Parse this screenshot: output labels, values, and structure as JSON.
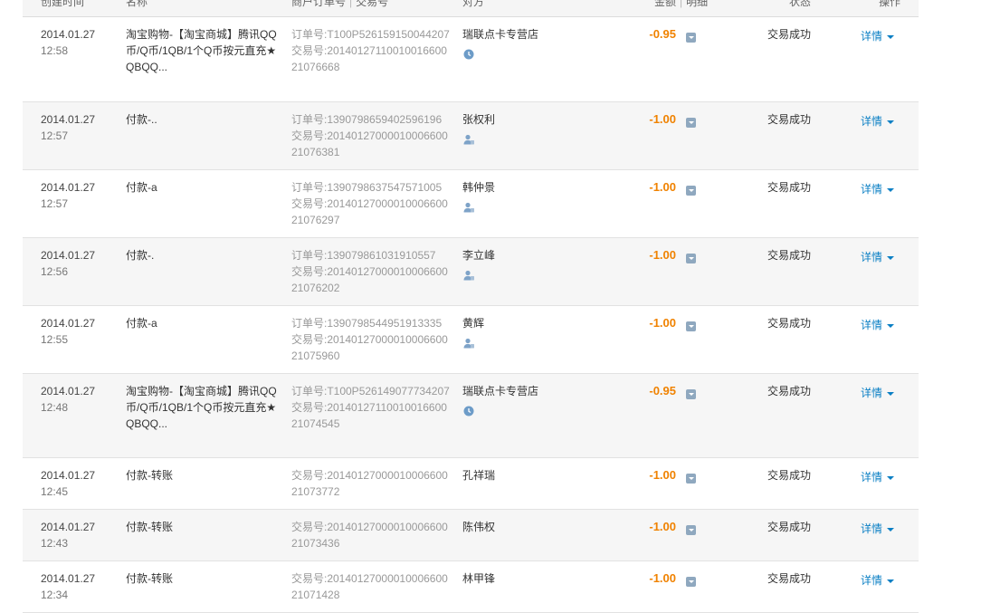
{
  "header": {
    "created_time": "创建时间",
    "name": "名称",
    "merchant_order": "商户订单号",
    "trade_no": "交易号",
    "counterparty": "对方",
    "amount": "金额",
    "detail": "明细",
    "status": "状态",
    "action": "操作"
  },
  "rows": [
    {
      "date": "2014.01.27",
      "time": "12:58",
      "name": "淘宝购物-【淘宝商城】腾讯QQ币/Q币/1QB/1个Q币按元直充★QBQQ...",
      "order": "订单号:T100P526159150044207",
      "trade": "交易号:2014012711001001660021076668",
      "party": "瑞联点卡专营店",
      "party_icon": "clock-icon",
      "amount": "-0.95",
      "status": "交易成功",
      "action": "详情"
    },
    {
      "date": "2014.01.27",
      "time": "12:57",
      "name": "付款-..",
      "order": "订单号:1390798659402596196",
      "trade": "交易号:2014012700001000660021076381",
      "party": "张权利",
      "party_icon": "user-icon",
      "amount": "-1.00",
      "status": "交易成功",
      "action": "详情"
    },
    {
      "date": "2014.01.27",
      "time": "12:57",
      "name": "付款-a",
      "order": "订单号:1390798637547571005",
      "trade": "交易号:2014012700001000660021076297",
      "party": "韩仲景",
      "party_icon": "user-icon",
      "amount": "-1.00",
      "status": "交易成功",
      "action": "详情"
    },
    {
      "date": "2014.01.27",
      "time": "12:56",
      "name": "付款-.",
      "order": "订单号:139079861031910557",
      "trade": "交易号:2014012700001000660021076202",
      "party": "李立峰",
      "party_icon": "user-icon",
      "amount": "-1.00",
      "status": "交易成功",
      "action": "详情"
    },
    {
      "date": "2014.01.27",
      "time": "12:55",
      "name": "付款-a",
      "order": "订单号:1390798544951913335",
      "trade": "交易号:2014012700001000660021075960",
      "party": "黄辉",
      "party_icon": "user-icon",
      "amount": "-1.00",
      "status": "交易成功",
      "action": "详情"
    },
    {
      "date": "2014.01.27",
      "time": "12:48",
      "name": "淘宝购物-【淘宝商城】腾讯QQ币/Q币/1QB/1个Q币按元直充★QBQQ...",
      "order": "订单号:T100P526149077734207",
      "trade": "交易号:2014012711001001660021074545",
      "party": "瑞联点卡专营店",
      "party_icon": "clock-icon",
      "amount": "-0.95",
      "status": "交易成功",
      "action": "详情"
    },
    {
      "date": "2014.01.27",
      "time": "12:45",
      "name": "付款-转账",
      "order": "",
      "trade": "交易号:2014012700001000660021073772",
      "party": "孔祥瑞",
      "party_icon": "",
      "amount": "-1.00",
      "status": "交易成功",
      "action": "详情"
    },
    {
      "date": "2014.01.27",
      "time": "12:43",
      "name": "付款-转账",
      "order": "",
      "trade": "交易号:2014012700001000660021073436",
      "party": "陈伟权",
      "party_icon": "",
      "amount": "-1.00",
      "status": "交易成功",
      "action": "详情"
    },
    {
      "date": "2014.01.27",
      "time": "12:34",
      "name": "付款-转账",
      "order": "",
      "trade": "交易号:2014012700001000660021071428",
      "party": "林甲锋",
      "party_icon": "",
      "amount": "-1.00",
      "status": "交易成功",
      "action": "详情"
    }
  ]
}
